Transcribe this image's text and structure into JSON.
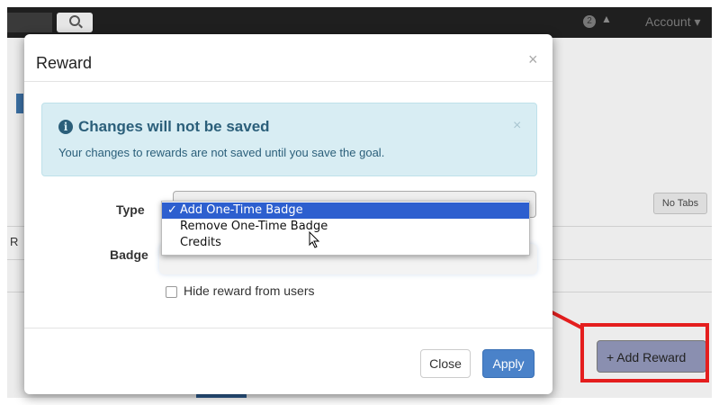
{
  "navbar": {
    "search_icon": "search-icon",
    "notification_count": "2",
    "bell_icon": "▲",
    "account_label": "Account ▾"
  },
  "background": {
    "no_tabs_label": "No Tabs",
    "row_letter": "R",
    "add_reward_label": "+ Add Reward"
  },
  "modal": {
    "title": "Reward",
    "close_glyph": "×",
    "alert": {
      "icon": "i",
      "title": "Changes will not be saved",
      "message": "Your changes to rewards are not saved until you save the goal.",
      "close_glyph": "×"
    },
    "type_label": "Type",
    "badge_label": "Badge",
    "type_options": [
      {
        "label": "Add One-Time Badge",
        "selected": true
      },
      {
        "label": "Remove One-Time Badge",
        "selected": false
      },
      {
        "label": "Credits",
        "selected": false
      }
    ],
    "check_mark": "✓",
    "hide_label": "Hide reward from users",
    "close_label": "Close",
    "apply_label": "Apply"
  },
  "colors": {
    "highlight": "#e41e1e",
    "apply": "#4a82c9",
    "alert_bg": "#d8edf3",
    "selected_option": "#2d5fcf"
  }
}
